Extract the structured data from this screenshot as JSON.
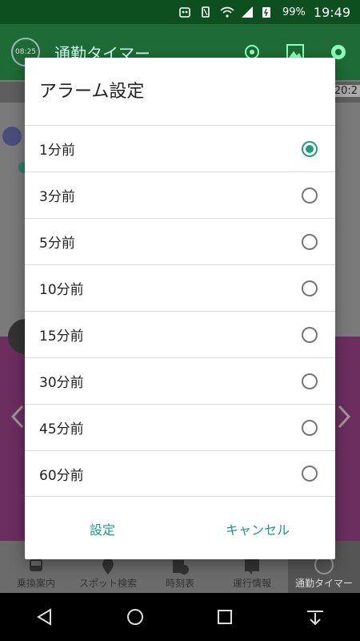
{
  "status_bar": {
    "battery": "99%",
    "time": "19:49"
  },
  "app_bar": {
    "logo_text": "08:25",
    "title": "通勤タイマー"
  },
  "background": {
    "time_snippet": "20:2"
  },
  "bottom_nav": [
    {
      "label": "乗換案内"
    },
    {
      "label": "スポット検索"
    },
    {
      "label": "時刻表"
    },
    {
      "label": "運行情報"
    },
    {
      "label": "通勤タイマー"
    }
  ],
  "dialog": {
    "title": "アラーム設定",
    "options": [
      {
        "label": "1分前",
        "checked": true
      },
      {
        "label": "3分前",
        "checked": false
      },
      {
        "label": "5分前",
        "checked": false
      },
      {
        "label": "10分前",
        "checked": false
      },
      {
        "label": "15分前",
        "checked": false
      },
      {
        "label": "30分前",
        "checked": false
      },
      {
        "label": "45分前",
        "checked": false
      },
      {
        "label": "60分前",
        "checked": false
      }
    ],
    "confirm_label": "設定",
    "cancel_label": "キャンセル"
  },
  "colors": {
    "accent": "#1f9e7d",
    "app_bar": "#1f6b35"
  }
}
